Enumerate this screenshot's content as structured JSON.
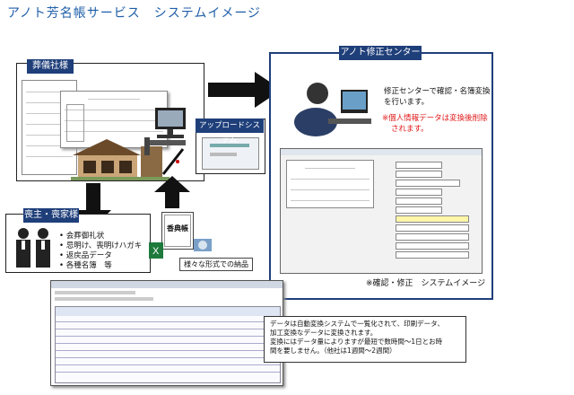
{
  "page_title": "アノト芳名帳サービス　システムイメージ",
  "funeral_company": {
    "label": "葬儀社様"
  },
  "upload_system": {
    "label": "アップロードシステム"
  },
  "center": {
    "label": "アノト修正センター",
    "description": [
      "修正センターで確認・名簿変換",
      "を行います。"
    ],
    "notice": [
      "※個人情報データは変換後削除",
      "されます。"
    ],
    "caption": "※確認・修正　システムイメージ"
  },
  "family": {
    "label": "喪主・喪家様",
    "items": [
      "会葬御礼状",
      "忌明け、喪明けハガキ",
      "返戻品データ",
      "各種名簿　等"
    ]
  },
  "guestbook": {
    "label": "香典帳"
  },
  "delivery": {
    "label": "様々な形式での納品"
  },
  "info_box": {
    "lines": [
      "データは自動変換システムで一覧化されて、印刷データ、",
      "加工変換なデータに変換されます。",
      "",
      "変換にはデータ量によりますが最短で数時間〜1日とお時",
      "間を要しません。（他社は1週間〜2週間）"
    ]
  },
  "colors": {
    "header_bg": "#1f3f7a",
    "title": "#1f5fa8",
    "notice": "#e01818",
    "arrow": "#111111"
  }
}
